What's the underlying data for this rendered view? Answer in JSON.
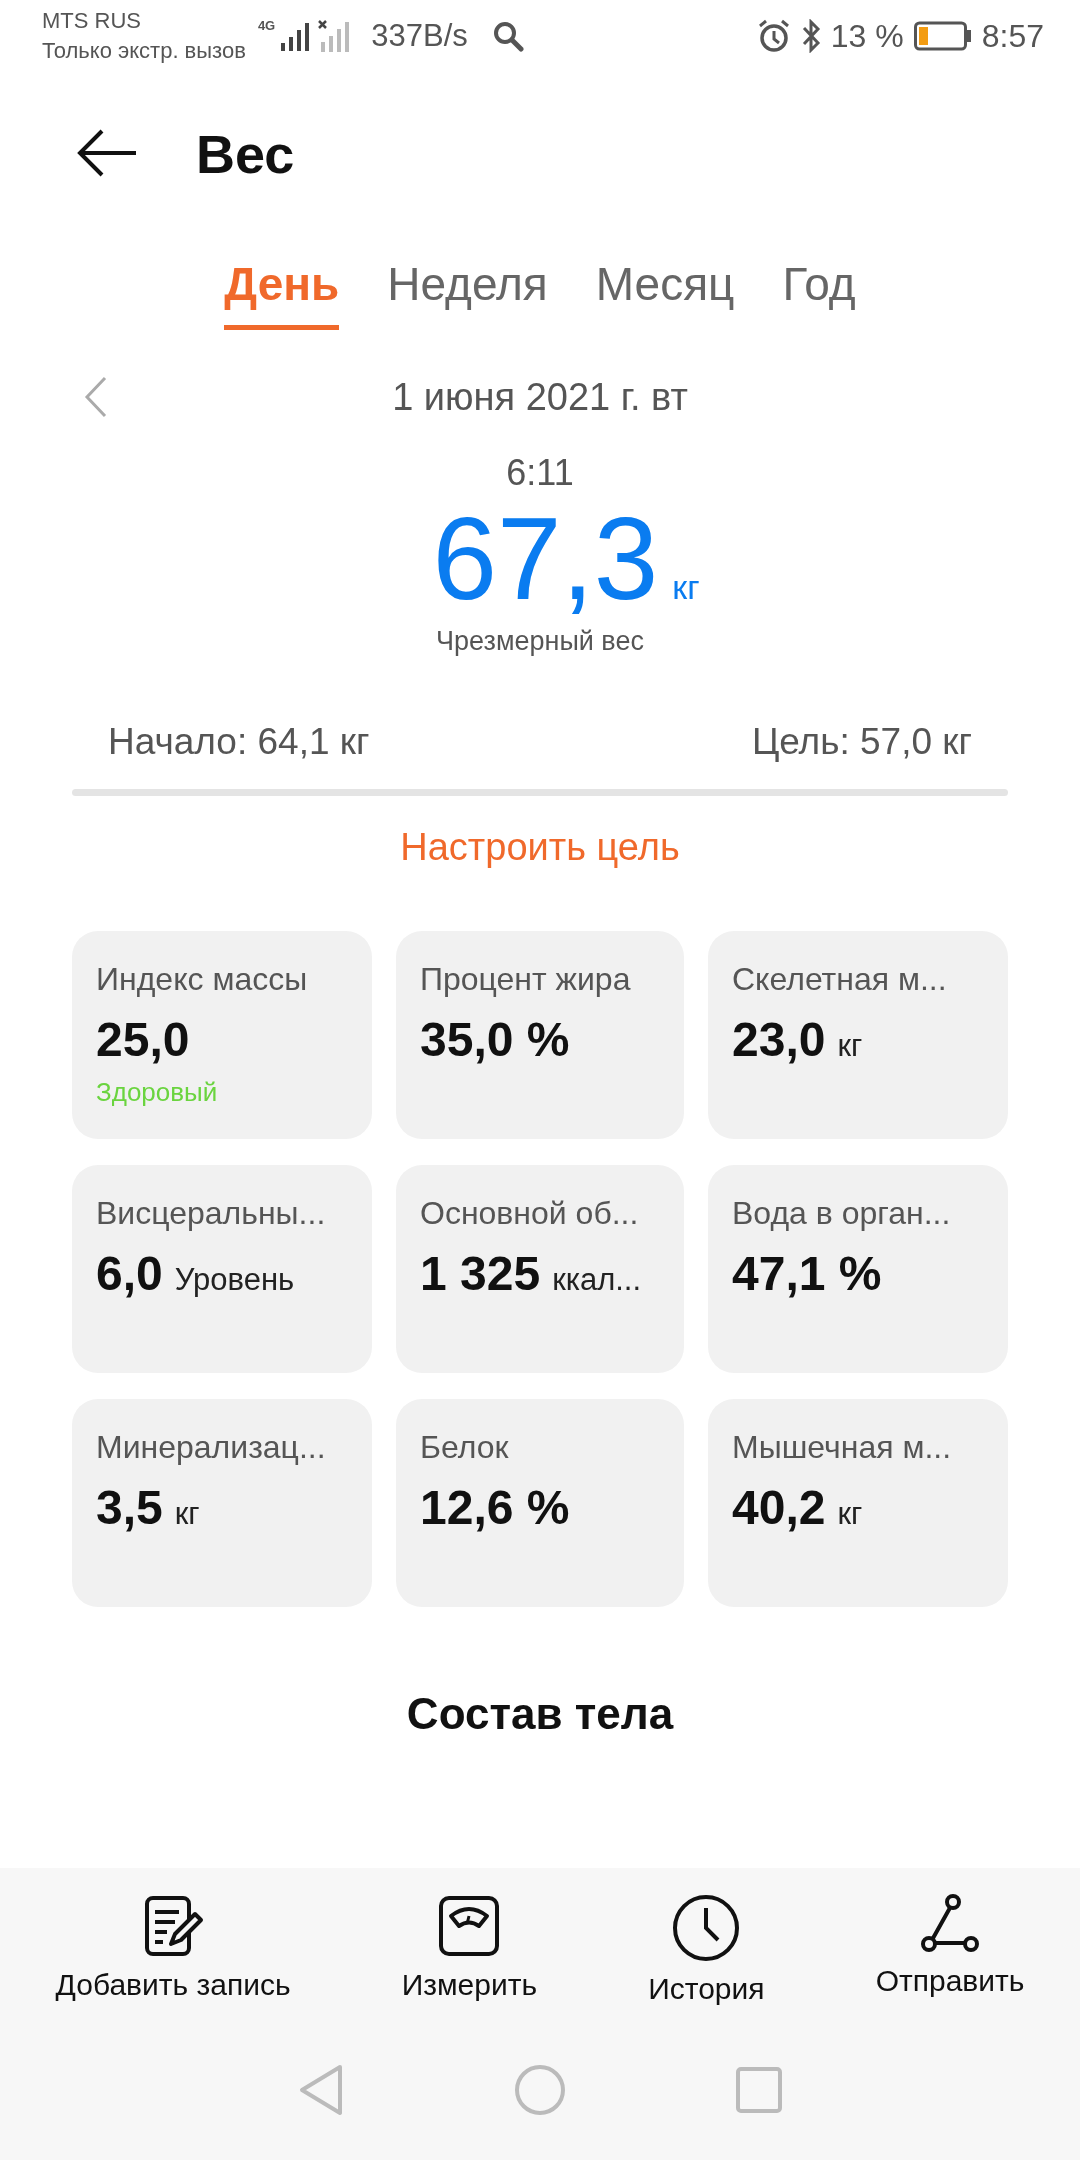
{
  "status_bar": {
    "carrier": "MTS RUS",
    "carrier_note": "Только экстр. вызов",
    "network": "4G",
    "speed": "337B/s",
    "battery": "13 %",
    "time": "8:57"
  },
  "header": {
    "title": "Вес"
  },
  "tabs": [
    {
      "label": "День",
      "selected": true
    },
    {
      "label": "Неделя",
      "selected": false
    },
    {
      "label": "Месяц",
      "selected": false
    },
    {
      "label": "Год",
      "selected": false
    }
  ],
  "date": "1 июня 2021 г. вт",
  "reading": {
    "time": "6:11",
    "value": "67,3",
    "unit": "кг",
    "status": "Чрезмерный вес"
  },
  "range": {
    "start": "Начало: 64,1 кг",
    "goal": "Цель: 57,0 кг"
  },
  "set_goal": "Настроить цель",
  "metrics": [
    {
      "label": "Индекс массы",
      "value": "25,0",
      "note": "Здоровый"
    },
    {
      "label": "Процент жира",
      "value": "35,0 %"
    },
    {
      "label": "Скелетная м...",
      "value": "23,0",
      "unit": "кг"
    },
    {
      "label": "Висцеральны...",
      "value": "6,0",
      "unit": "Уровень"
    },
    {
      "label": "Основной об...",
      "value": "1 325",
      "unit": "ккал..."
    },
    {
      "label": "Вода в орган...",
      "value": "47,1 %"
    },
    {
      "label": "Минерализац...",
      "value": "3,5",
      "unit": "кг"
    },
    {
      "label": "Белок",
      "value": "12,6 %"
    },
    {
      "label": "Мышечная м...",
      "value": "40,2",
      "unit": "кг"
    }
  ],
  "section_title": "Состав тела",
  "actions": [
    {
      "kind": "add",
      "label": "Добавить запись"
    },
    {
      "kind": "measure",
      "label": "Измерить"
    },
    {
      "kind": "history",
      "label": "История"
    },
    {
      "kind": "share",
      "label": "Отправить"
    }
  ]
}
